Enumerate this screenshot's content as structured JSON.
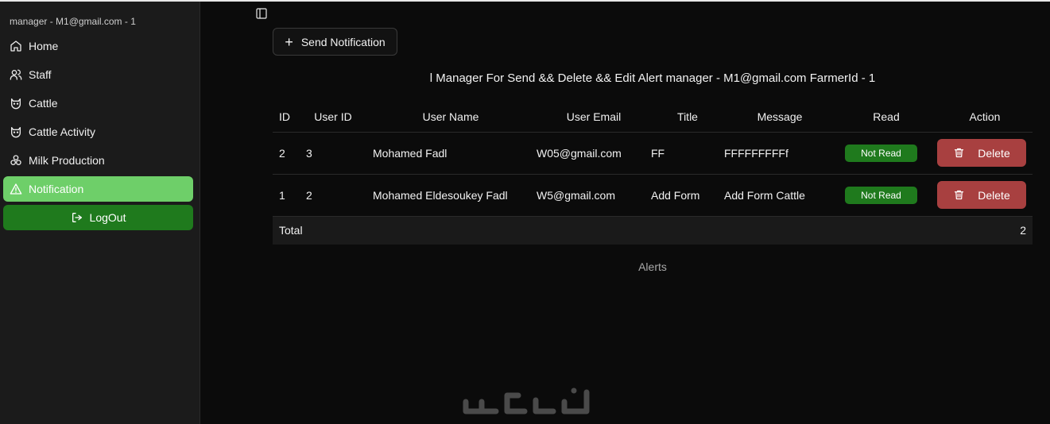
{
  "sidebar": {
    "user_label": "manager - M1@gmail.com - 1",
    "items": [
      {
        "label": "Home",
        "icon": "home-icon"
      },
      {
        "label": "Staff",
        "icon": "users-icon"
      },
      {
        "label": "Cattle",
        "icon": "cat-icon"
      },
      {
        "label": "Cattle Activity",
        "icon": "cat-icon"
      },
      {
        "label": "Milk Production",
        "icon": "milk-icon"
      },
      {
        "label": "Notification",
        "icon": "alert-triangle-icon",
        "active": true
      }
    ],
    "logout_label": "LogOut"
  },
  "toolbar": {
    "send_label": "Send Notification"
  },
  "table": {
    "caption": "l Manager For Send && Delete && Edit Alert manager - M1@gmail.com FarmerId - 1",
    "headers": {
      "id": "ID",
      "user_id": "User ID",
      "user_name": "User Name",
      "user_email": "User Email",
      "title": "Title",
      "message": "Message",
      "read": "Read",
      "action": "Action"
    },
    "rows": [
      {
        "id": "2",
        "user_id": "3",
        "user_name": "Mohamed Fadl",
        "user_email": "W05@gmail.com",
        "title": "FF",
        "message": "FFFFFFFFFf",
        "read": "Not Read",
        "action": "Delete"
      },
      {
        "id": "1",
        "user_id": "2",
        "user_name": "Mohamed Eldesoukey Fadl",
        "user_email": "W5@gmail.com",
        "title": "Add Form",
        "message": "Add Form Cattle",
        "read": "Not Read",
        "action": "Delete"
      }
    ],
    "total_label": "Total",
    "total_value": "2",
    "footer_caption": "Alerts"
  },
  "colors": {
    "active_nav": "#6ecf69",
    "logout_bg": "#1f7a1d",
    "badge_bg": "#1f7a1d",
    "delete_bg": "#a84040"
  }
}
